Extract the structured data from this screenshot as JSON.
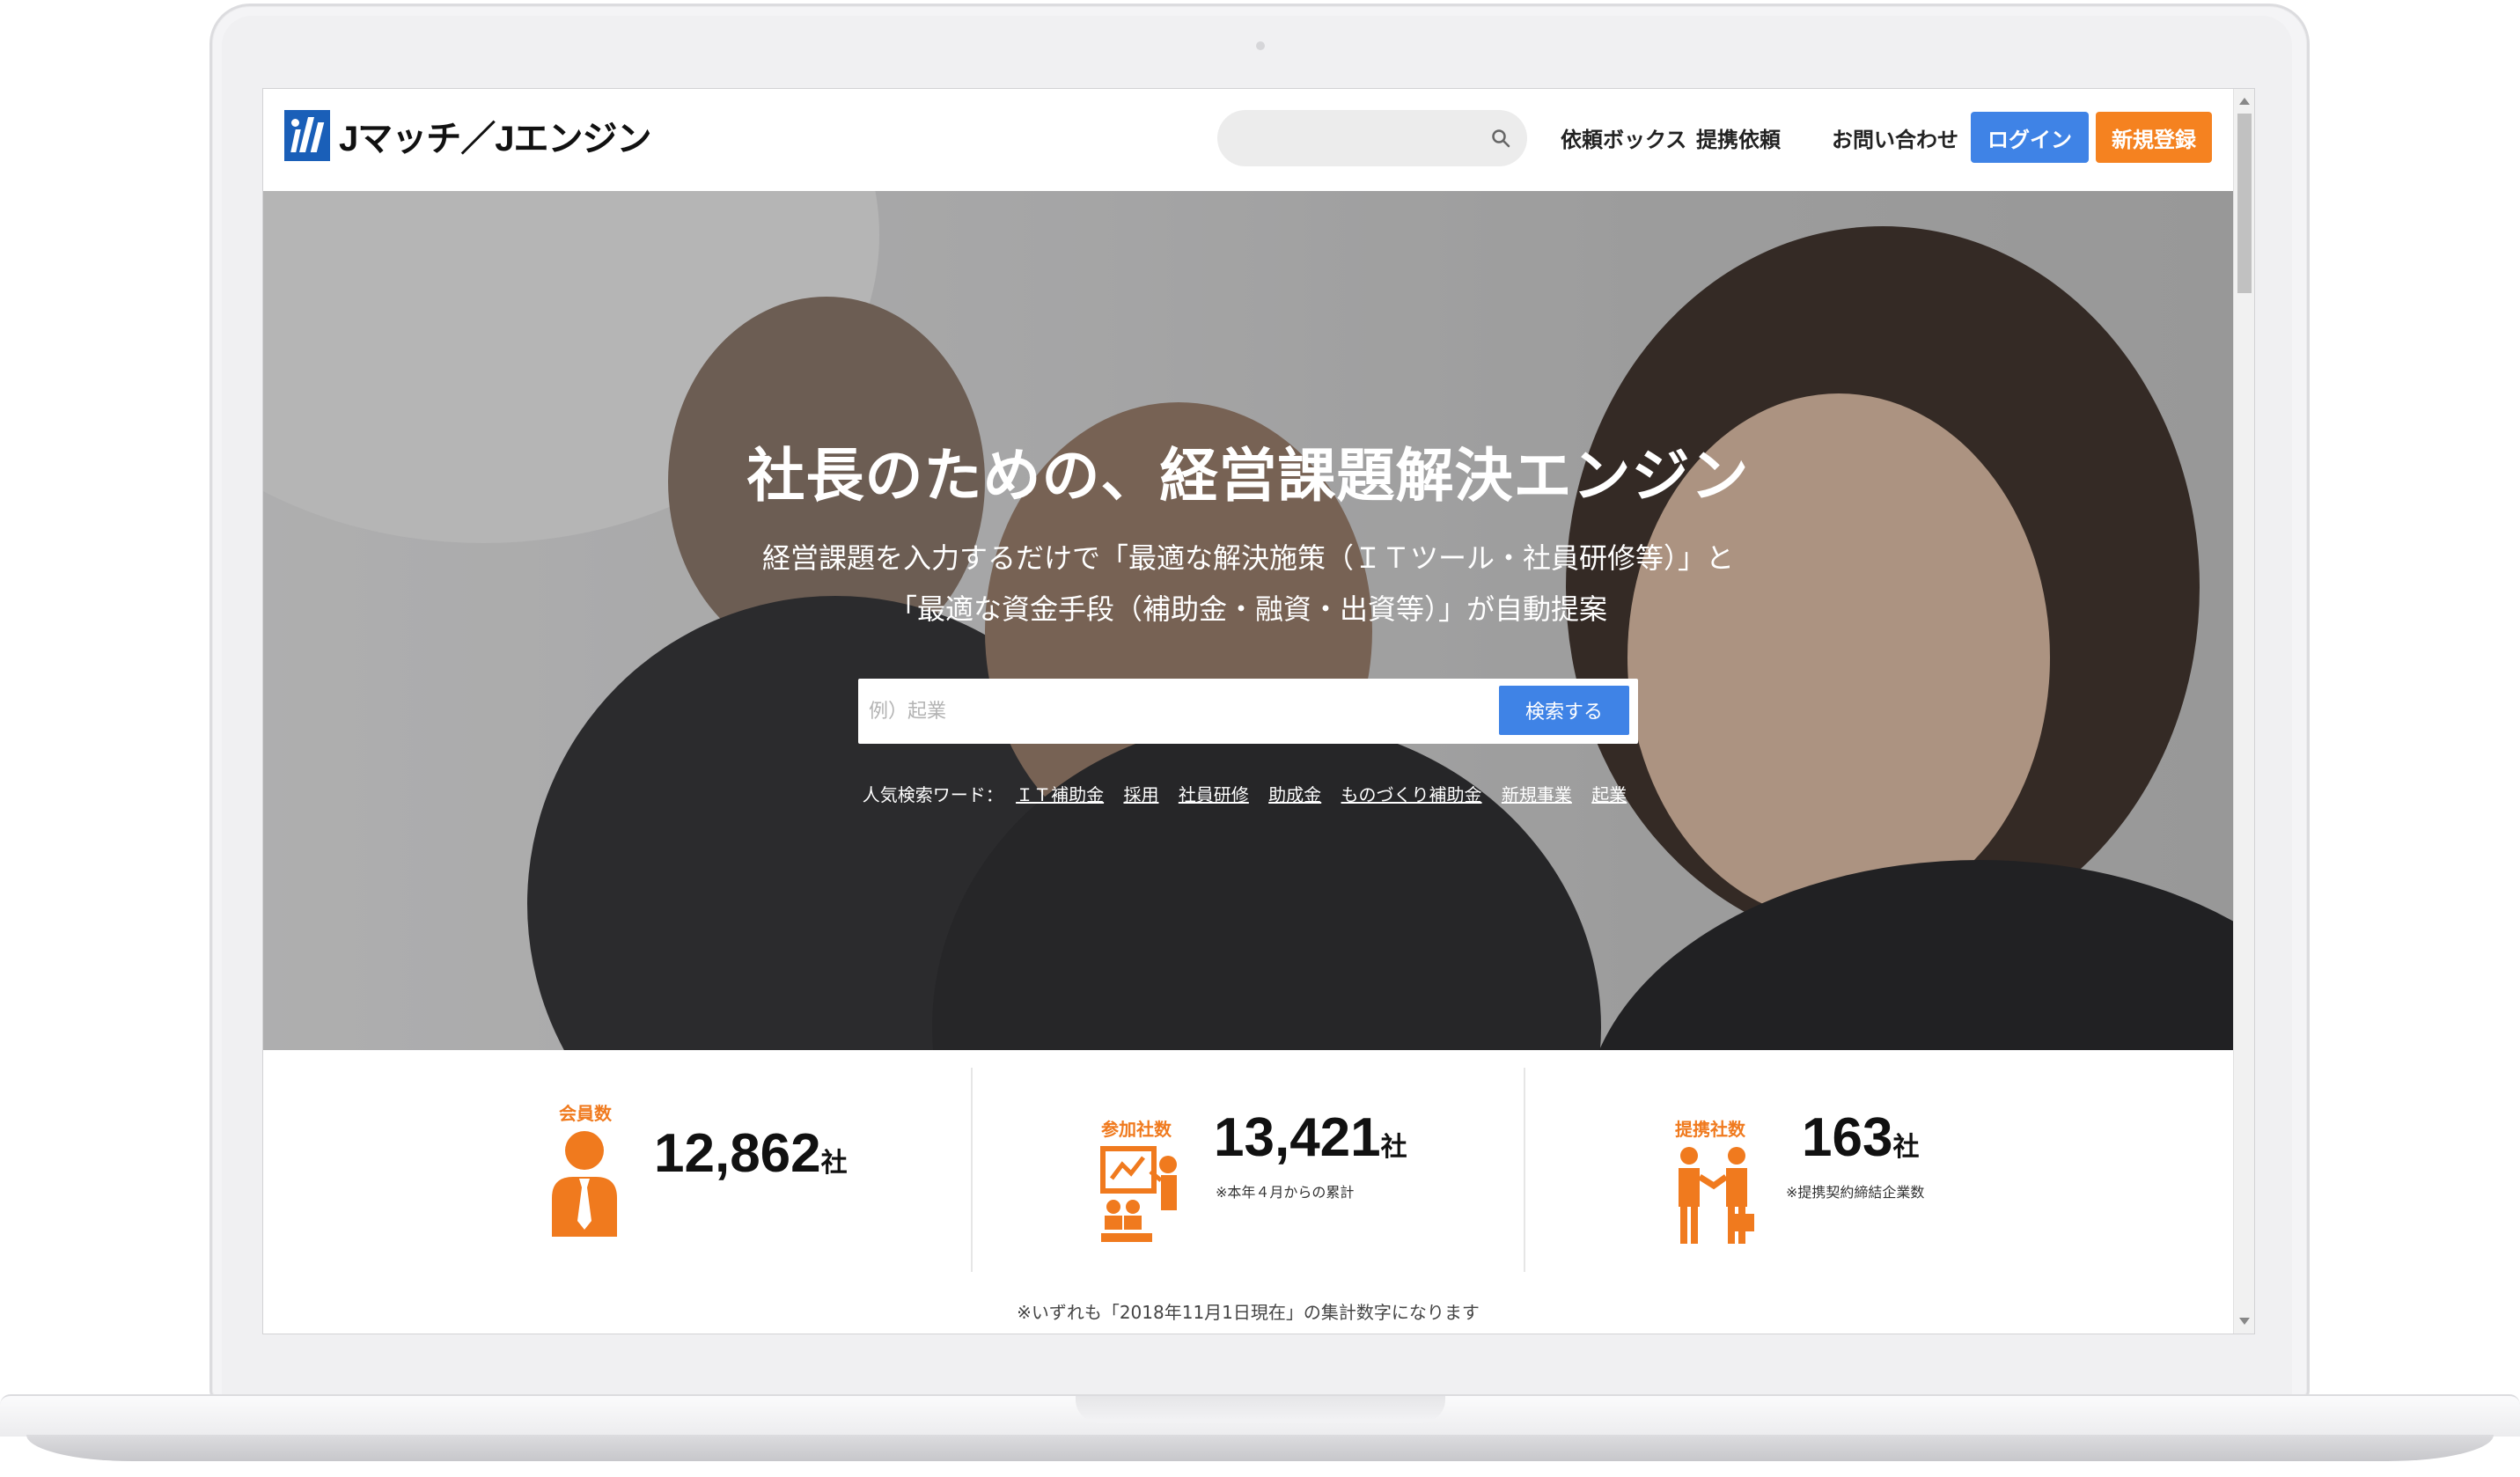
{
  "header": {
    "logo_text": "Jマッチ／Jエンジン",
    "search_placeholder": "",
    "nav": [
      "依頼ボックス",
      "提携依頼",
      "お問い合わせ"
    ],
    "login_label": "ログイン",
    "register_label": "新規登録"
  },
  "hero": {
    "title": "社長のための、経営課題解決エンジン",
    "subtitle_line1": "経営課題を入力するだけで「最適な解決施策（ＩＴツール・社員研修等）」と",
    "subtitle_line2": "「最適な資金手段（補助金・融資・出資等）」が自動提案",
    "search_placeholder": "例）起業",
    "search_button": "検索する",
    "popular_label": "人気検索ワード：",
    "popular_keywords": [
      "ＩＴ補助金",
      "採用",
      "社員研修",
      "助成金",
      "ものづくり補助金",
      "新規事業",
      "起業"
    ]
  },
  "stats": {
    "members": {
      "label": "会員数",
      "value": "12,862",
      "unit": "社"
    },
    "participants": {
      "label": "参加社数",
      "value": "13,421",
      "unit": "社",
      "note": "※本年４月からの累計"
    },
    "partners": {
      "label": "提携社数",
      "value": "163",
      "unit": "社",
      "note": "※提携契約締結企業数"
    },
    "footnote": "※いずれも「2018年11月1日現在」の集計数字になります"
  },
  "colors": {
    "accent_blue": "#3f83e6",
    "accent_orange": "#f58220",
    "stat_orange": "#f07a1e"
  }
}
